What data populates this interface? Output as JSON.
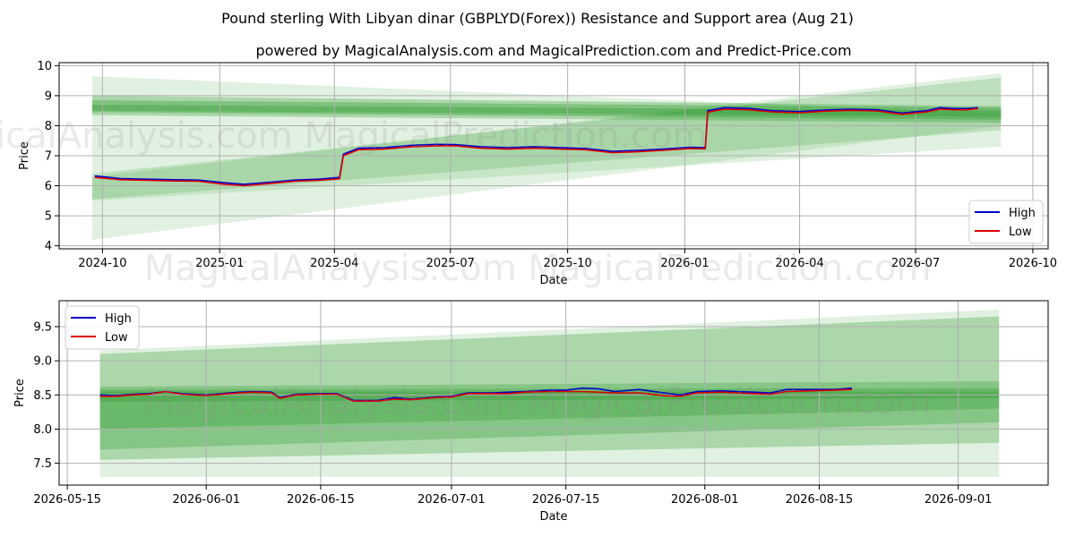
{
  "title": "Pound sterling With Libyan dinar (GBPLYD(Forex)) Resistance and Support area (Aug 21)",
  "subtitle": "powered by MagicalAnalysis.com and MagicalPrediction.com and Predict-Price.com",
  "watermark": "MagicalAnalysis.com    MagicalPrediction.com",
  "colors": {
    "high": "#0000cc",
    "low": "#dd0000",
    "band": "#2e9a2e",
    "grid": "#b0b0b0"
  },
  "chart_data": [
    {
      "type": "line",
      "xlabel": "Date",
      "ylabel": "Price",
      "xlim": [
        "2024-08-28",
        "2026-10-13"
      ],
      "ylim": [
        3.9,
        10.1
      ],
      "x_ticks": [
        "2024-10",
        "2025-01",
        "2025-04",
        "2025-07",
        "2025-10",
        "2026-01",
        "2026-04",
        "2026-07",
        "2026-10"
      ],
      "y_ticks": [
        4,
        5,
        6,
        7,
        8,
        9,
        10
      ],
      "legend": "lower-right",
      "grid": true,
      "series": [
        {
          "name": "High",
          "points": [
            [
              "2024-09-25",
              6.33
            ],
            [
              "2024-10-15",
              6.24
            ],
            [
              "2024-11-05",
              6.22
            ],
            [
              "2024-11-25",
              6.2
            ],
            [
              "2024-12-15",
              6.19
            ],
            [
              "2025-01-05",
              6.1
            ],
            [
              "2025-01-20",
              6.05
            ],
            [
              "2025-02-10",
              6.12
            ],
            [
              "2025-03-01",
              6.19
            ],
            [
              "2025-03-20",
              6.22
            ],
            [
              "2025-04-05",
              6.28
            ],
            [
              "2025-04-08",
              7.05
            ],
            [
              "2025-04-20",
              7.25
            ],
            [
              "2025-05-10",
              7.27
            ],
            [
              "2025-06-01",
              7.35
            ],
            [
              "2025-06-20",
              7.38
            ],
            [
              "2025-07-05",
              7.37
            ],
            [
              "2025-07-25",
              7.3
            ],
            [
              "2025-08-15",
              7.27
            ],
            [
              "2025-09-05",
              7.3
            ],
            [
              "2025-09-25",
              7.27
            ],
            [
              "2025-10-15",
              7.24
            ],
            [
              "2025-11-05",
              7.15
            ],
            [
              "2025-11-25",
              7.18
            ],
            [
              "2025-12-15",
              7.22
            ],
            [
              "2026-01-05",
              7.28
            ],
            [
              "2026-01-17",
              7.27
            ],
            [
              "2026-01-19",
              8.5
            ],
            [
              "2026-02-01",
              8.6
            ],
            [
              "2026-02-20",
              8.58
            ],
            [
              "2026-03-10",
              8.5
            ],
            [
              "2026-04-01",
              8.47
            ],
            [
              "2026-04-20",
              8.52
            ],
            [
              "2026-05-10",
              8.55
            ],
            [
              "2026-06-01",
              8.53
            ],
            [
              "2026-06-20",
              8.42
            ],
            [
              "2026-07-10",
              8.5
            ],
            [
              "2026-07-20",
              8.6
            ],
            [
              "2026-08-01",
              8.57
            ],
            [
              "2026-08-10",
              8.57
            ],
            [
              "2026-08-19",
              8.6
            ]
          ]
        },
        {
          "name": "Low",
          "points": [
            [
              "2024-09-25",
              6.28
            ],
            [
              "2024-10-15",
              6.2
            ],
            [
              "2024-11-05",
              6.18
            ],
            [
              "2024-11-25",
              6.16
            ],
            [
              "2024-12-15",
              6.15
            ],
            [
              "2025-01-05",
              6.05
            ],
            [
              "2025-01-20",
              6.0
            ],
            [
              "2025-02-10",
              6.08
            ],
            [
              "2025-03-01",
              6.15
            ],
            [
              "2025-03-20",
              6.18
            ],
            [
              "2025-04-05",
              6.23
            ],
            [
              "2025-04-08",
              7.0
            ],
            [
              "2025-04-20",
              7.2
            ],
            [
              "2025-05-10",
              7.22
            ],
            [
              "2025-06-01",
              7.3
            ],
            [
              "2025-06-20",
              7.33
            ],
            [
              "2025-07-05",
              7.33
            ],
            [
              "2025-07-25",
              7.25
            ],
            [
              "2025-08-15",
              7.22
            ],
            [
              "2025-09-05",
              7.25
            ],
            [
              "2025-09-25",
              7.22
            ],
            [
              "2025-10-15",
              7.2
            ],
            [
              "2025-11-05",
              7.1
            ],
            [
              "2025-11-25",
              7.13
            ],
            [
              "2025-12-15",
              7.18
            ],
            [
              "2026-01-05",
              7.24
            ],
            [
              "2026-01-17",
              7.23
            ],
            [
              "2026-01-19",
              8.45
            ],
            [
              "2026-02-01",
              8.55
            ],
            [
              "2026-02-20",
              8.53
            ],
            [
              "2026-03-10",
              8.46
            ],
            [
              "2026-04-01",
              8.43
            ],
            [
              "2026-04-20",
              8.48
            ],
            [
              "2026-05-10",
              8.51
            ],
            [
              "2026-06-01",
              8.49
            ],
            [
              "2026-06-20",
              8.38
            ],
            [
              "2026-07-10",
              8.46
            ],
            [
              "2026-07-20",
              8.55
            ],
            [
              "2026-08-01",
              8.53
            ],
            [
              "2026-08-10",
              8.53
            ],
            [
              "2026-08-19",
              8.57
            ]
          ]
        }
      ],
      "bands": [
        {
          "start": "2024-09-23",
          "end": "2026-09-06",
          "upper_start": 9.65,
          "upper_end": 8.4,
          "lower_start": 4.2,
          "lower_end": 8.0,
          "opacity": 0.14
        },
        {
          "start": "2024-09-23",
          "end": "2026-09-06",
          "upper_start": 6.3,
          "upper_end": 9.75,
          "lower_start": 5.5,
          "lower_end": 7.3,
          "opacity": 0.14
        },
        {
          "start": "2024-09-23",
          "end": "2026-09-06",
          "upper_start": 6.4,
          "upper_end": 9.6,
          "lower_start": 5.55,
          "lower_end": 7.85,
          "opacity": 0.2
        },
        {
          "start": "2024-09-23",
          "end": "2026-09-06",
          "upper_start": 9.0,
          "upper_end": 8.65,
          "lower_start": 8.35,
          "lower_end": 8.1,
          "opacity": 0.3
        },
        {
          "start": "2024-09-23",
          "end": "2026-09-06",
          "upper_start": 8.85,
          "upper_end": 8.6,
          "lower_start": 8.45,
          "lower_end": 8.2,
          "opacity": 0.35
        },
        {
          "start": "2024-09-23",
          "end": "2026-09-06",
          "upper_start": 8.7,
          "upper_end": 8.5,
          "lower_start": 8.5,
          "lower_end": 8.3,
          "opacity": 0.35
        }
      ]
    },
    {
      "type": "line",
      "xlabel": "Date",
      "ylabel": "Price",
      "xlim": [
        "2026-05-14",
        "2026-09-12"
      ],
      "ylim": [
        7.18,
        9.88
      ],
      "x_ticks": [
        "2026-05-15",
        "2026-06-01",
        "2026-06-15",
        "2026-07-01",
        "2026-07-15",
        "2026-08-01",
        "2026-08-15",
        "2026-09-01"
      ],
      "y_ticks": [
        7.5,
        8.0,
        8.5,
        9.0,
        9.5
      ],
      "legend": "upper-left",
      "grid": true,
      "series": [
        {
          "name": "High",
          "points": [
            [
              "2026-05-19",
              8.5
            ],
            [
              "2026-05-21",
              8.49
            ],
            [
              "2026-05-23",
              8.51
            ],
            [
              "2026-05-25",
              8.52
            ],
            [
              "2026-05-27",
              8.55
            ],
            [
              "2026-05-29",
              8.52
            ],
            [
              "2026-06-01",
              8.5
            ],
            [
              "2026-06-03",
              8.52
            ],
            [
              "2026-06-05",
              8.54
            ],
            [
              "2026-06-07",
              8.55
            ],
            [
              "2026-06-09",
              8.54
            ],
            [
              "2026-06-10",
              8.46
            ],
            [
              "2026-06-12",
              8.51
            ],
            [
              "2026-06-15",
              8.52
            ],
            [
              "2026-06-17",
              8.52
            ],
            [
              "2026-06-19",
              8.42
            ],
            [
              "2026-06-22",
              8.42
            ],
            [
              "2026-06-24",
              8.46
            ],
            [
              "2026-06-26",
              8.44
            ],
            [
              "2026-06-29",
              8.47
            ],
            [
              "2026-07-01",
              8.48
            ],
            [
              "2026-07-03",
              8.53
            ],
            [
              "2026-07-06",
              8.53
            ],
            [
              "2026-07-08",
              8.54
            ],
            [
              "2026-07-10",
              8.55
            ],
            [
              "2026-07-13",
              8.57
            ],
            [
              "2026-07-15",
              8.57
            ],
            [
              "2026-07-17",
              8.6
            ],
            [
              "2026-07-19",
              8.59
            ],
            [
              "2026-07-21",
              8.55
            ],
            [
              "2026-07-24",
              8.58
            ],
            [
              "2026-07-27",
              8.53
            ],
            [
              "2026-07-29",
              8.5
            ],
            [
              "2026-07-31",
              8.55
            ],
            [
              "2026-08-03",
              8.56
            ],
            [
              "2026-08-05",
              8.55
            ],
            [
              "2026-08-07",
              8.54
            ],
            [
              "2026-08-09",
              8.53
            ],
            [
              "2026-08-11",
              8.58
            ],
            [
              "2026-08-14",
              8.58
            ],
            [
              "2026-08-17",
              8.58
            ],
            [
              "2026-08-19",
              8.6
            ]
          ]
        },
        {
          "name": "Low",
          "points": [
            [
              "2026-05-19",
              8.48
            ],
            [
              "2026-05-21",
              8.48
            ],
            [
              "2026-05-23",
              8.5
            ],
            [
              "2026-05-25",
              8.51
            ],
            [
              "2026-05-27",
              8.55
            ],
            [
              "2026-05-29",
              8.51
            ],
            [
              "2026-06-01",
              8.49
            ],
            [
              "2026-06-03",
              8.51
            ],
            [
              "2026-06-05",
              8.53
            ],
            [
              "2026-06-07",
              8.54
            ],
            [
              "2026-06-09",
              8.53
            ],
            [
              "2026-06-10",
              8.45
            ],
            [
              "2026-06-12",
              8.5
            ],
            [
              "2026-06-15",
              8.51
            ],
            [
              "2026-06-17",
              8.51
            ],
            [
              "2026-06-19",
              8.41
            ],
            [
              "2026-06-22",
              8.41
            ],
            [
              "2026-06-24",
              8.44
            ],
            [
              "2026-06-26",
              8.43
            ],
            [
              "2026-06-29",
              8.46
            ],
            [
              "2026-07-01",
              8.47
            ],
            [
              "2026-07-03",
              8.52
            ],
            [
              "2026-07-06",
              8.52
            ],
            [
              "2026-07-08",
              8.52
            ],
            [
              "2026-07-10",
              8.54
            ],
            [
              "2026-07-13",
              8.55
            ],
            [
              "2026-07-15",
              8.55
            ],
            [
              "2026-07-17",
              8.55
            ],
            [
              "2026-07-19",
              8.54
            ],
            [
              "2026-07-21",
              8.53
            ],
            [
              "2026-07-24",
              8.53
            ],
            [
              "2026-07-27",
              8.49
            ],
            [
              "2026-07-29",
              8.48
            ],
            [
              "2026-07-31",
              8.53
            ],
            [
              "2026-08-03",
              8.54
            ],
            [
              "2026-08-05",
              8.53
            ],
            [
              "2026-08-07",
              8.52
            ],
            [
              "2026-08-09",
              8.51
            ],
            [
              "2026-08-11",
              8.55
            ],
            [
              "2026-08-14",
              8.56
            ],
            [
              "2026-08-17",
              8.57
            ],
            [
              "2026-08-19",
              8.58
            ]
          ]
        }
      ],
      "bands": [
        {
          "start": "2026-05-19",
          "end": "2026-09-06",
          "upper_start": 9.15,
          "upper_end": 9.75,
          "lower_start": 7.3,
          "lower_end": 7.3,
          "opacity": 0.14
        },
        {
          "start": "2026-05-19",
          "end": "2026-09-06",
          "upper_start": 9.1,
          "upper_end": 9.65,
          "lower_start": 7.55,
          "lower_end": 7.8,
          "opacity": 0.3
        },
        {
          "start": "2026-05-19",
          "end": "2026-09-06",
          "upper_start": 8.62,
          "upper_end": 8.7,
          "lower_start": 7.7,
          "lower_end": 8.1,
          "opacity": 0.3
        },
        {
          "start": "2026-05-19",
          "end": "2026-09-06",
          "upper_start": 8.58,
          "upper_end": 8.6,
          "lower_start": 8.0,
          "lower_end": 8.3,
          "opacity": 0.3
        },
        {
          "start": "2026-05-19",
          "end": "2026-09-06",
          "upper_start": 8.55,
          "upper_end": 8.55,
          "lower_start": 8.4,
          "lower_end": 8.45,
          "opacity": 0.35
        }
      ]
    }
  ]
}
